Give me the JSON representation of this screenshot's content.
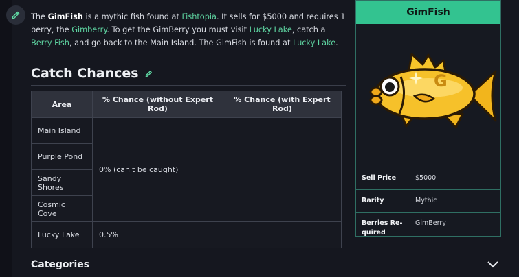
{
  "intro": {
    "p1": "The ",
    "name": "GimFish",
    "p2": " is a mythic fish found at ",
    "link_fishtopia": "Fishtopia",
    "p3": ". It sells for $5000 and requires 1 berry, the ",
    "link_gimberry": "Gimberry",
    "p4": ". To get the GimBerry you must visit ",
    "link_lucky_lake": "Lucky Lake",
    "p5": ", catch a ",
    "link_berry_fish": "Berry Fish",
    "p6": ", and go back to the Main Island. The GimFish is found at ",
    "link_lucky_lake_2": "Lucky Lake",
    "p7": "."
  },
  "section": {
    "title": "Catch Chances"
  },
  "table": {
    "headers": [
      "Area",
      "% Chance (without Expert Rod)",
      "% Chance (with Expert Rod)"
    ],
    "areas": [
      "Main Island",
      "Purple Pond",
      "Sandy Shores",
      "Cosmic Cove",
      "Lucky Lake"
    ],
    "merged_value": "0% (can't be caught)",
    "lucky_lake_value": "0.5%"
  },
  "categories": {
    "label": "Categories"
  },
  "infobox": {
    "title": "GimFish",
    "fish_letter": "G",
    "rows": [
      {
        "key": "Sell Price",
        "value": "$5000"
      },
      {
        "key": "Rarity",
        "value": "Mythic"
      },
      {
        "key": "Berries Re-quired",
        "value": "GimBerry"
      }
    ]
  },
  "colors": {
    "accent": "#33c390",
    "link": "#5fd7a3",
    "background": "#15171f"
  }
}
